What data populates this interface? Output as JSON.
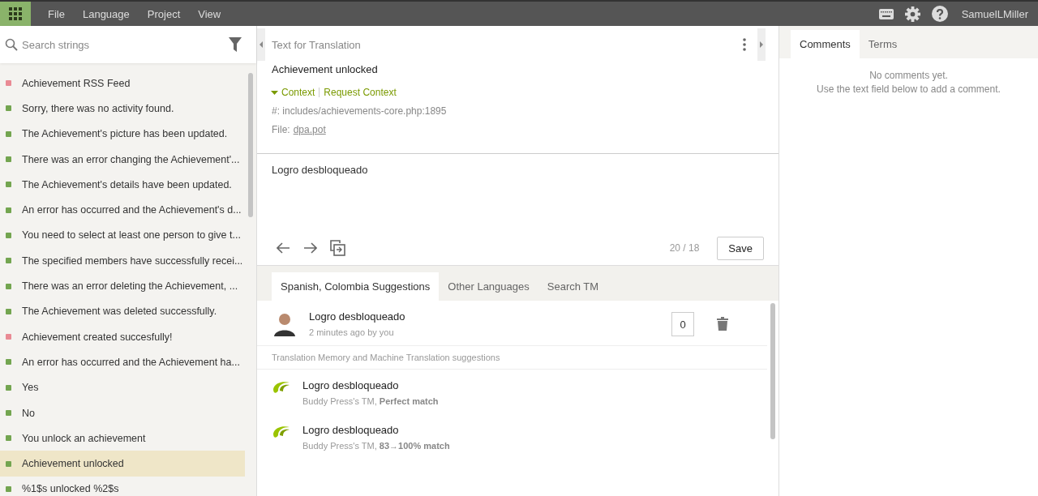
{
  "menu_bar": {
    "items": [
      "File",
      "Language",
      "Project",
      "View"
    ],
    "user": "SamuelLMiller"
  },
  "sidebar": {
    "search": {
      "placeholder": "Search strings"
    },
    "items": [
      {
        "text": "Achievement RSS Feed",
        "color": "#e98a94",
        "selected": false
      },
      {
        "text": "Sorry, there was no activity found.",
        "color": "#73a550",
        "selected": false
      },
      {
        "text": "The Achievement's picture has been updated.",
        "color": "#73a550",
        "selected": false
      },
      {
        "text": "There was an error changing the Achievement'...",
        "color": "#73a550",
        "selected": false
      },
      {
        "text": "The Achievement's details have been updated.",
        "color": "#73a550",
        "selected": false
      },
      {
        "text": "An error has occurred and the Achievement's d...",
        "color": "#73a550",
        "selected": false
      },
      {
        "text": "You need to select at least one person to give t...",
        "color": "#73a550",
        "selected": false
      },
      {
        "text": "The specified members have successfully recei...",
        "color": "#73a550",
        "selected": false
      },
      {
        "text": "There was an error deleting the Achievement, ...",
        "color": "#73a550",
        "selected": false
      },
      {
        "text": "The Achievement was deleted successfully.",
        "color": "#73a550",
        "selected": false
      },
      {
        "text": "Achievement created succesfully!",
        "color": "#e98a94",
        "selected": false
      },
      {
        "text": "An error has occurred and the Achievement ha...",
        "color": "#73a550",
        "selected": false
      },
      {
        "text": "Yes",
        "color": "#73a550",
        "selected": false
      },
      {
        "text": "No",
        "color": "#73a550",
        "selected": false
      },
      {
        "text": "You unlock an achievement",
        "color": "#73a550",
        "selected": false
      },
      {
        "text": "Achievement unlocked",
        "color": "#73a550",
        "selected": true
      },
      {
        "text": "%1$s unlocked %2$s",
        "color": "#73a550",
        "selected": false
      }
    ]
  },
  "editor": {
    "title": "Text for Translation",
    "source": "Achievement unlocked",
    "context": {
      "expanded": true,
      "label": "Context",
      "request_label": "Request Context",
      "reference": "#: includes/achievements-core.php:1895",
      "file_label": "File:",
      "file": "dpa.pot"
    },
    "translation": "Logro desbloqueado",
    "counter": "20 / 18",
    "save": "Save"
  },
  "suggestions": {
    "tabs": [
      {
        "label": "Spanish, Colombia Suggestions",
        "selected": true
      },
      {
        "label": "Other Languages",
        "selected": false
      },
      {
        "label": "Search TM",
        "selected": false
      }
    ],
    "own": [
      {
        "text": "Logro desbloqueado",
        "meta": "2 minutes ago by you",
        "votes": "0"
      }
    ],
    "section": "Translation Memory and Machine Translation suggestions",
    "tm": [
      {
        "text": "Logro desbloqueado",
        "meta": "Buddy Press's TM, **Perfect match**"
      },
      {
        "text": "Logro desbloqueado",
        "meta": "Buddy Press's TM, **83→100% match**"
      }
    ]
  },
  "comments": {
    "tabs": [
      {
        "label": "Comments",
        "selected": true
      },
      {
        "label": "Terms",
        "selected": false
      }
    ],
    "empty": "No comments yet.",
    "hint": "Use the text field below to add a comment."
  }
}
